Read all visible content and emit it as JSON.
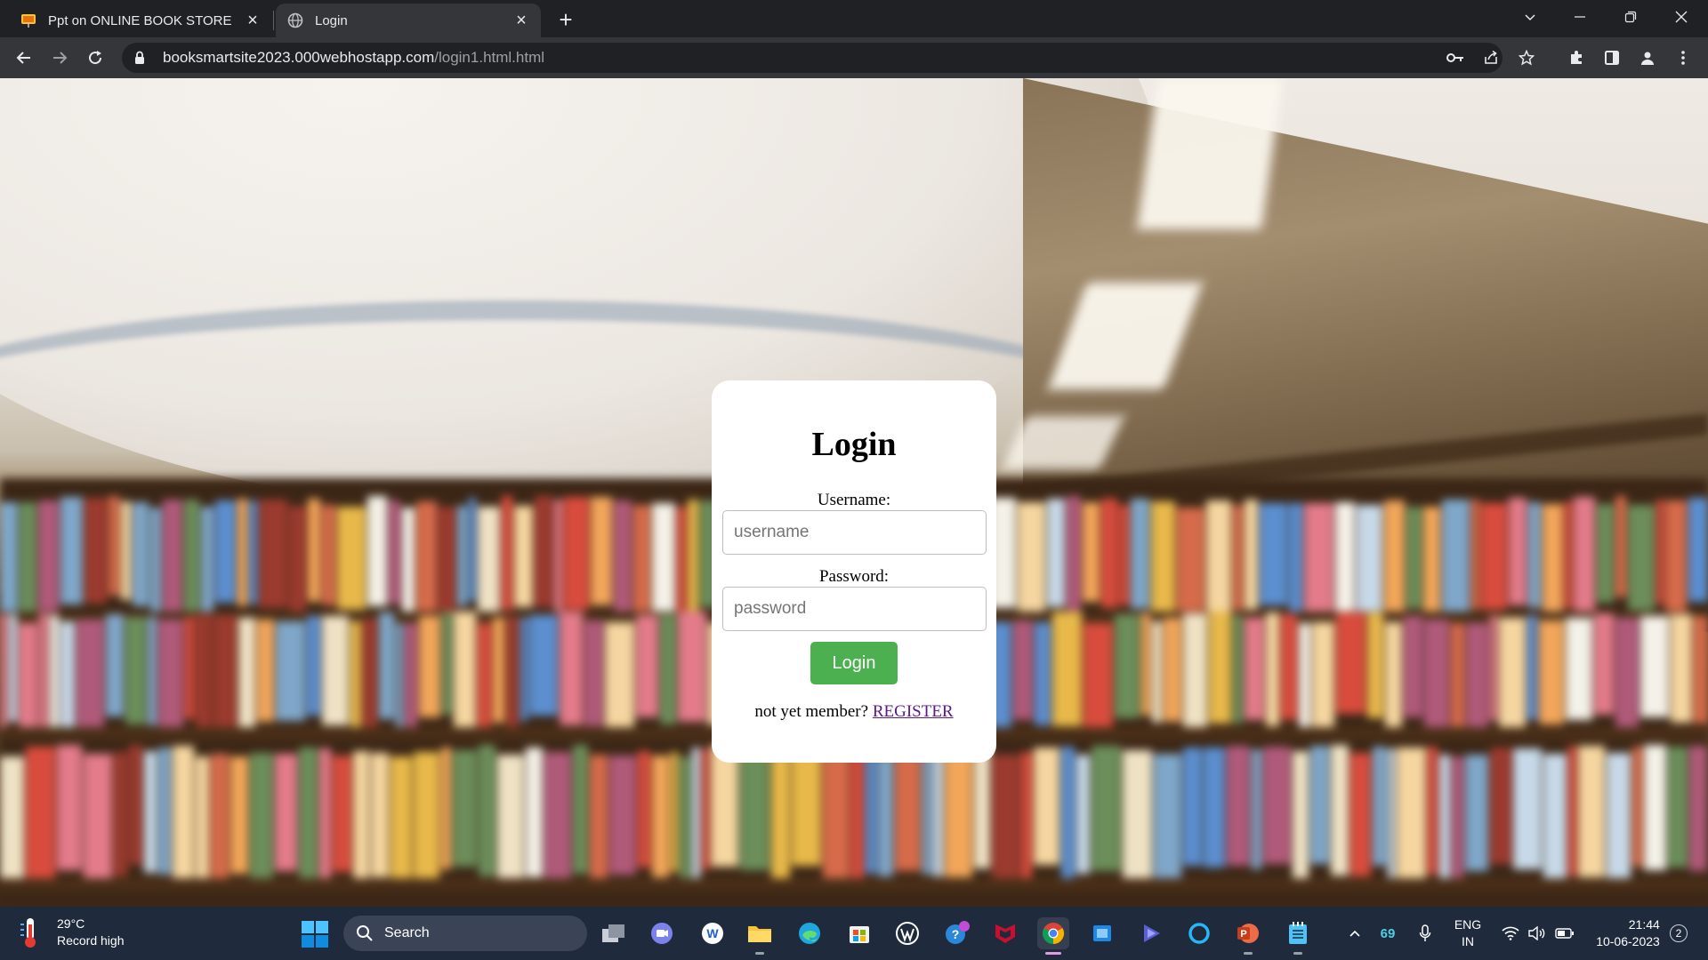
{
  "browser": {
    "tabs": [
      {
        "title": "Ppt on ONLINE BOOK STORE",
        "active": false
      },
      {
        "title": "Login",
        "active": true
      }
    ],
    "url_host": "booksmartsite2023.000webhostapp.com",
    "url_path": "/login1.html.html"
  },
  "login": {
    "heading": "Login",
    "username_label": "Username:",
    "username_placeholder": "username",
    "password_label": "Password:",
    "password_placeholder": "password",
    "submit_label": "Login",
    "footer_text": "not yet member? ",
    "register_link": "REGISTER"
  },
  "taskbar": {
    "weather_temp": "29°C",
    "weather_desc": "Record high",
    "search_label": "Search",
    "tray_badge_value": "69",
    "language_line1": "ENG",
    "language_line2": "IN",
    "clock_time": "21:44",
    "clock_date": "10-06-2023",
    "notification_count": "2"
  },
  "colors": {
    "login_button": "#4caf50",
    "register_link": "#551a8b",
    "taskbar": "#1f2a3c",
    "browser_frame": "#202124"
  }
}
